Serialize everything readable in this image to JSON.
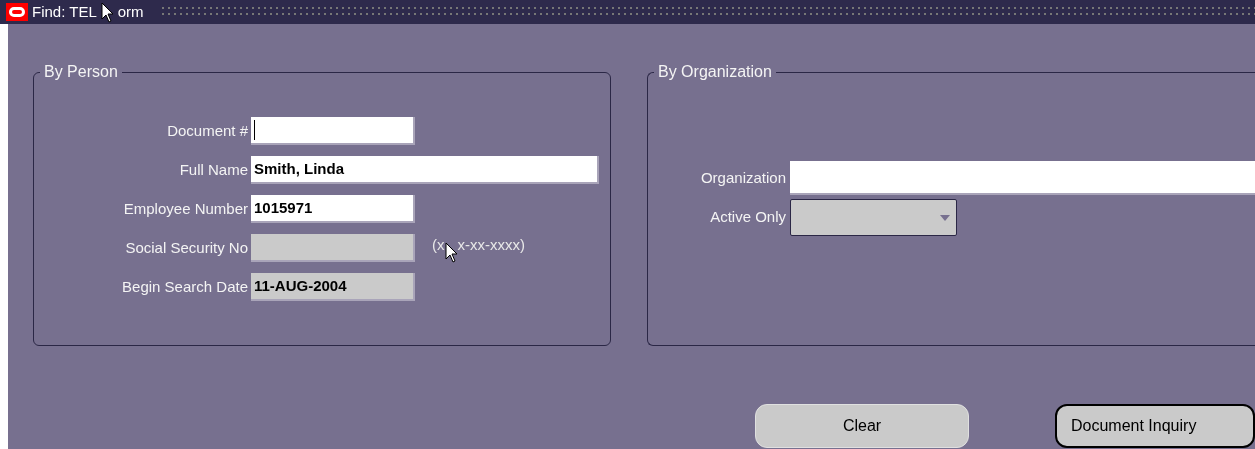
{
  "window": {
    "title": [
      "Find: TEL",
      "orm"
    ]
  },
  "by_person": {
    "title": "By Person",
    "fields": [
      {
        "label": "Document #",
        "disabled": false,
        "focused": true,
        "wide": false
      },
      {
        "label": "Full Name",
        "value": "Smith, Linda",
        "disabled": false,
        "focused": false,
        "wide": true
      },
      {
        "label": "Employee Number",
        "value": "1015971",
        "disabled": false,
        "focused": false,
        "wide": false
      },
      {
        "label": "Social Security No",
        "disabled": true,
        "focused": false,
        "wide": false,
        "hint": [
          "(x",
          "x-xx-xxxx)"
        ]
      },
      {
        "label": "Begin Search Date",
        "value": "11-AUG-2004",
        "disabled": true,
        "focused": false,
        "wide": false
      }
    ]
  },
  "by_organization": {
    "title": "By Organization",
    "organization": {
      "label": "Organization"
    },
    "active_only": {
      "label": "Active Only"
    }
  },
  "buttons": [
    {
      "label": "Clear",
      "selected": false
    },
    {
      "label": "Document Inquiry",
      "selected": true
    }
  ]
}
